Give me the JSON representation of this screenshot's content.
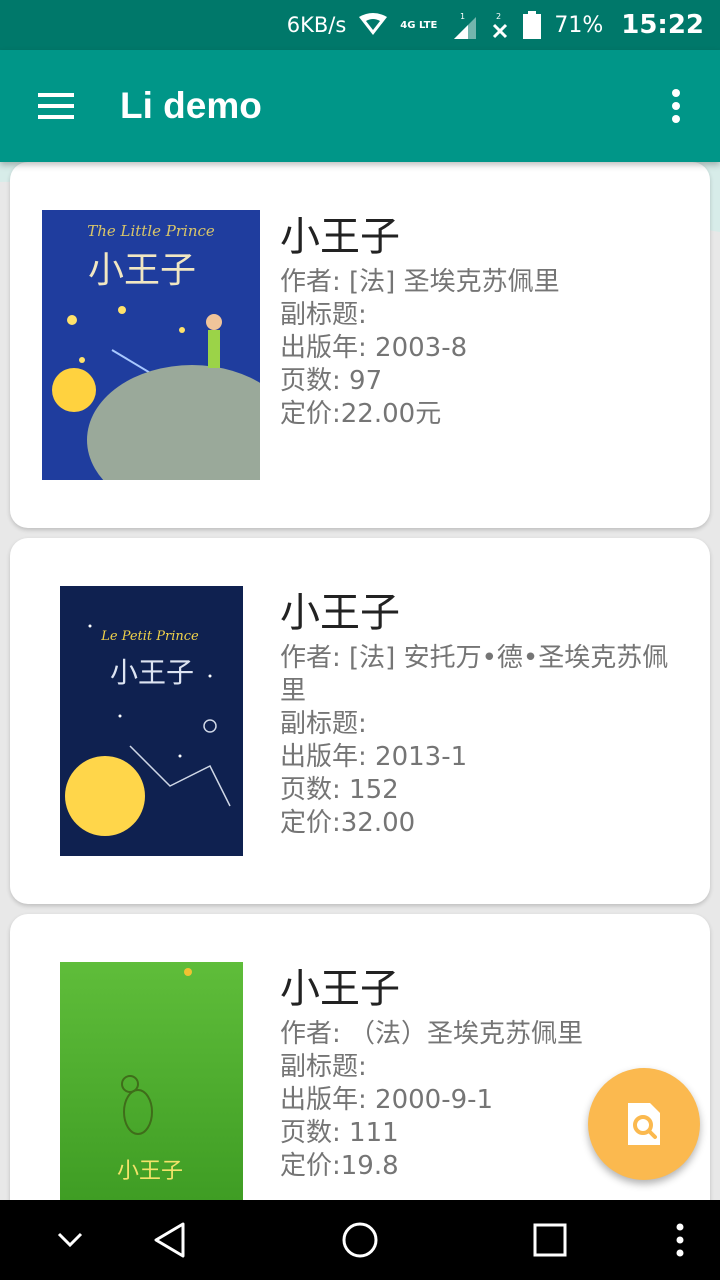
{
  "status_bar": {
    "net_speed": "6KB/s",
    "network_type": "4G LTE",
    "sim_badge_1": "1",
    "sim_badge_2": "2",
    "battery": "71%",
    "time": "15:22",
    "icons": [
      "wifi-icon",
      "signal-icon",
      "no-signal-icon",
      "battery-icon"
    ]
  },
  "app_bar": {
    "title": "Li demo",
    "icons": [
      "hamburger-menu-icon",
      "more-vert-icon"
    ]
  },
  "books": [
    {
      "title": "小王子",
      "author": "作者: [法] 圣埃克苏佩里",
      "subtitle": "副标题:",
      "year": "出版年: 2003-8",
      "pages": "页数: 97",
      "price": "定价:22.00元",
      "cover": {
        "text": "小王子",
        "top_text": "The Little Prince",
        "bg": "#1e3aa0"
      }
    },
    {
      "title": "小王子",
      "author": "作者: [法] 安托万•德•圣埃克苏佩里",
      "subtitle": "副标题:",
      "year": "出版年: 2013-1",
      "pages": "页数: 152",
      "price": "定价:32.00",
      "cover": {
        "text": "小王子",
        "top_text": "Le Petit Prince",
        "bg": "#0e1f4a"
      }
    },
    {
      "title": "小王子",
      "author": "作者: （法）圣埃克苏佩里",
      "subtitle": "副标题:",
      "year": "出版年: 2000-9-1",
      "pages": "页数: 111",
      "price": "定价:19.8",
      "cover": {
        "text": "小王子",
        "bg": "#4caa2f"
      }
    }
  ],
  "fab": {
    "icon": "search-document-icon",
    "color": "#fbb94f"
  },
  "nav_bar": {
    "icons": [
      "chevron-down-icon",
      "back-icon",
      "home-icon",
      "recents-icon",
      "more-vert-icon"
    ]
  },
  "colors": {
    "status": "#00786a",
    "primary": "#009688",
    "accent": "#fbb94f"
  }
}
